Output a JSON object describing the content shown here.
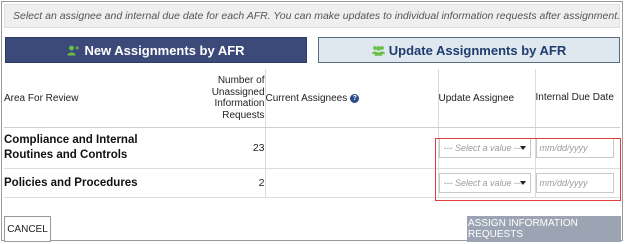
{
  "notice": "Select an assignee and internal due date for each AFR. You can make updates to individual information requests after assignment.",
  "tabs": [
    {
      "label": "New Assignments by AFR",
      "icon": "user-plus-icon"
    },
    {
      "label": "Update Assignments by AFR",
      "icon": "users-icon"
    }
  ],
  "table": {
    "headers": {
      "area": "Area For Review",
      "number": "Number of Unassigned Information Requests",
      "current": "Current Assignees",
      "update": "Update Assignee",
      "due": "Internal Due Date"
    },
    "rows": [
      {
        "area": "Compliance and Internal Routines and Controls",
        "count": "23",
        "current": "",
        "assignee_placeholder": "--- Select a value ---",
        "due_placeholder": "mm/dd/yyyy"
      },
      {
        "area": "Policies and Procedures",
        "count": "2",
        "current": "",
        "assignee_placeholder": "--- Select a value ---",
        "due_placeholder": "mm/dd/yyyy"
      }
    ]
  },
  "buttons": {
    "cancel": "CANCEL",
    "assign": "ASSIGN INFORMATION REQUESTS"
  },
  "colors": {
    "tab_active": "#3c4a7a",
    "tab_inactive": "#dfe7ef",
    "icon_green": "#6abf45",
    "assign_disabled": "#9ca3b3",
    "highlight": "#e53c3c"
  }
}
